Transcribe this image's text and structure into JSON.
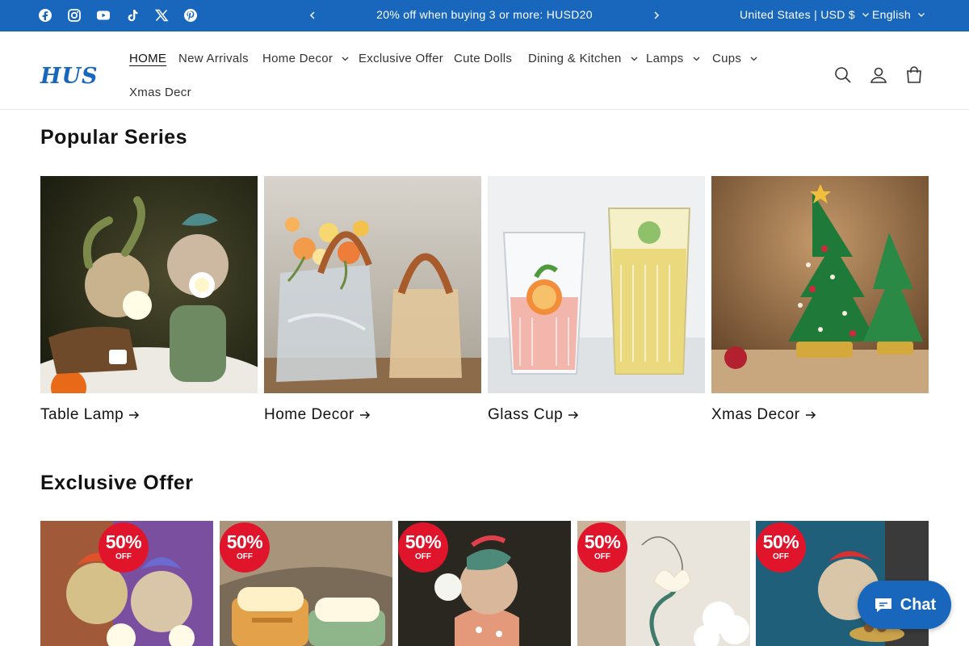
{
  "announcement": {
    "text": "20% off when buying 3 or more: HUSD20",
    "social": [
      "facebook-icon",
      "instagram-icon",
      "youtube-icon",
      "tiktok-icon",
      "x-icon",
      "pinterest-icon"
    ],
    "country": "United States | USD $",
    "language": "English",
    "bg_color": "#1867bd"
  },
  "header": {
    "logo": "HUS",
    "nav": [
      {
        "label": "HOME",
        "dropdown": false,
        "active": true
      },
      {
        "label": "New Arrivals",
        "dropdown": false
      },
      {
        "label": "Home Decor",
        "dropdown": true
      },
      {
        "label": "Exclusive Offer",
        "dropdown": false
      },
      {
        "label": "Cute Dolls",
        "dropdown": false
      },
      {
        "label": "Dining & Kitchen",
        "dropdown": true
      },
      {
        "label": "Lamps",
        "dropdown": true
      },
      {
        "label": "Cups",
        "dropdown": true
      },
      {
        "label": "Xmas Decr",
        "dropdown": false
      }
    ],
    "icons": [
      "search-icon",
      "account-icon",
      "cart-icon"
    ]
  },
  "popular": {
    "title": "Popular Series",
    "items": [
      {
        "label": "Table Lamp"
      },
      {
        "label": "Home Decor"
      },
      {
        "label": "Glass Cup"
      },
      {
        "label": "Xmas Decor"
      }
    ]
  },
  "exclusive": {
    "title": "Exclusive Offer",
    "badge_pct": "50%",
    "badge_off": "OFF",
    "items": [
      {
        "badge_pct": "50%",
        "badge_off": "OFF"
      },
      {
        "badge_pct": "50%",
        "badge_off": "OFF"
      },
      {
        "badge_pct": "50%",
        "badge_off": "OFF"
      },
      {
        "badge_pct": "50%",
        "badge_off": "OFF"
      },
      {
        "badge_pct": "50%",
        "badge_off": "OFF"
      }
    ]
  },
  "chat": {
    "label": "Chat"
  }
}
